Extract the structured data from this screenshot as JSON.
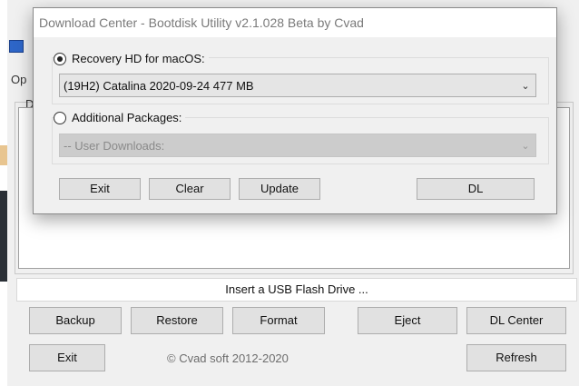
{
  "main_window": {
    "menu_partial": "Op",
    "group_partial": "D",
    "status_text": "Insert a USB Flash Drive ...",
    "buttons": {
      "backup": "Backup",
      "restore": "Restore",
      "format": "Format",
      "eject": "Eject",
      "dl_center": "DL Center",
      "exit": "Exit",
      "refresh": "Refresh"
    },
    "copyright": "© Cvad soft 2012-2020"
  },
  "dialog": {
    "title": "Download Center - Bootdisk Utility v2.1.028 Beta by Cvad",
    "recovery_radio": {
      "label": "Recovery HD for macOS:",
      "checked": true
    },
    "recovery_select": {
      "value": "(19H2) Catalina 2020-09-24 477 MB",
      "icon": "chevron-down-icon"
    },
    "packages_radio": {
      "label": "Additional Packages:",
      "checked": false
    },
    "packages_select": {
      "value": "-- User Downloads:",
      "disabled": true,
      "icon": "chevron-down-icon"
    },
    "buttons": {
      "exit": "Exit",
      "clear": "Clear",
      "update": "Update",
      "dl": "DL"
    }
  }
}
